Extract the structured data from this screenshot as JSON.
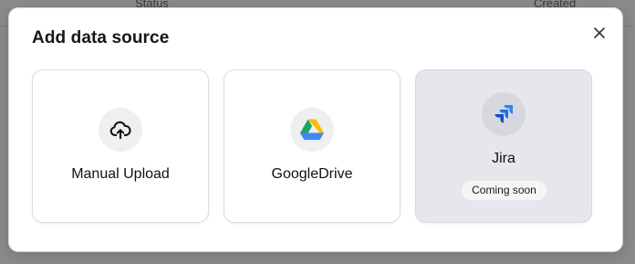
{
  "background": {
    "columns": [
      "Status",
      "Created"
    ]
  },
  "modal": {
    "title": "Add data source",
    "close_icon": "close-icon",
    "sources": [
      {
        "label": "Manual Upload",
        "icon": "cloud-upload-icon"
      },
      {
        "label": "GoogleDrive",
        "icon": "google-drive-icon"
      },
      {
        "label": "Jira",
        "icon": "jira-icon",
        "badge": "Coming soon",
        "disabled": true
      }
    ]
  },
  "colors": {
    "overlay": "#8b8b8b",
    "disabled_card": "#e6e6ec",
    "jira_blue": "#2684ff",
    "drive_green": "#1ea362",
    "drive_yellow": "#ffba00",
    "drive_blue": "#4285f4"
  }
}
